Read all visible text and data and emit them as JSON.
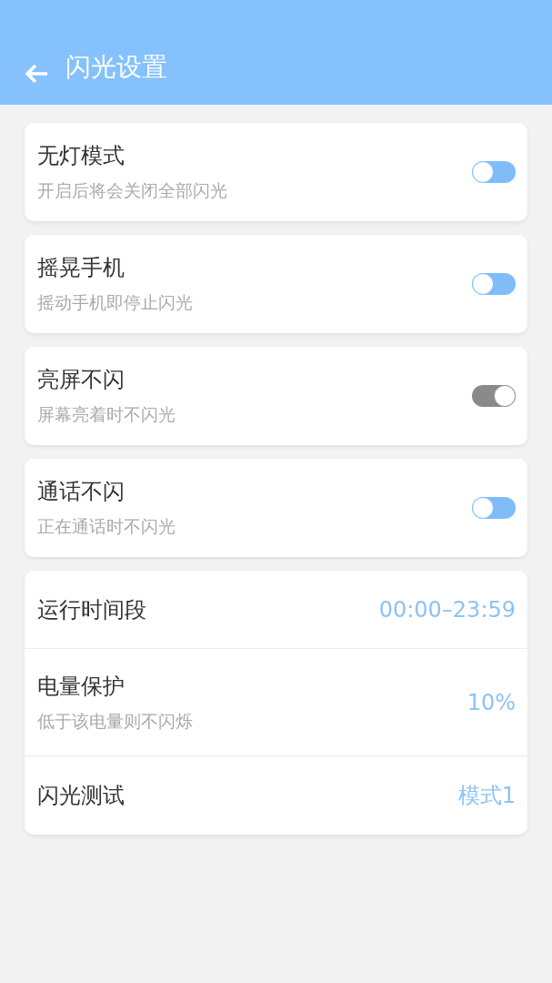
{
  "header": {
    "title": "闪光设置"
  },
  "toggles": [
    {
      "title": "无灯模式",
      "subtitle": "开启后将会关闭全部闪光",
      "on": false
    },
    {
      "title": "摇晃手机",
      "subtitle": "摇动手机即停止闪光",
      "on": false
    },
    {
      "title": "亮屏不闪",
      "subtitle": "屏幕亮着时不闪光",
      "on": true
    },
    {
      "title": "通话不闪",
      "subtitle": "正在通话时不闪光",
      "on": false
    }
  ],
  "settings": [
    {
      "title": "运行时间段",
      "value": "00:00–23:59"
    },
    {
      "title": "电量保护",
      "subtitle": "低于该电量则不闪烁",
      "value": "10%"
    },
    {
      "title": "闪光测试",
      "value": "模式1"
    }
  ]
}
